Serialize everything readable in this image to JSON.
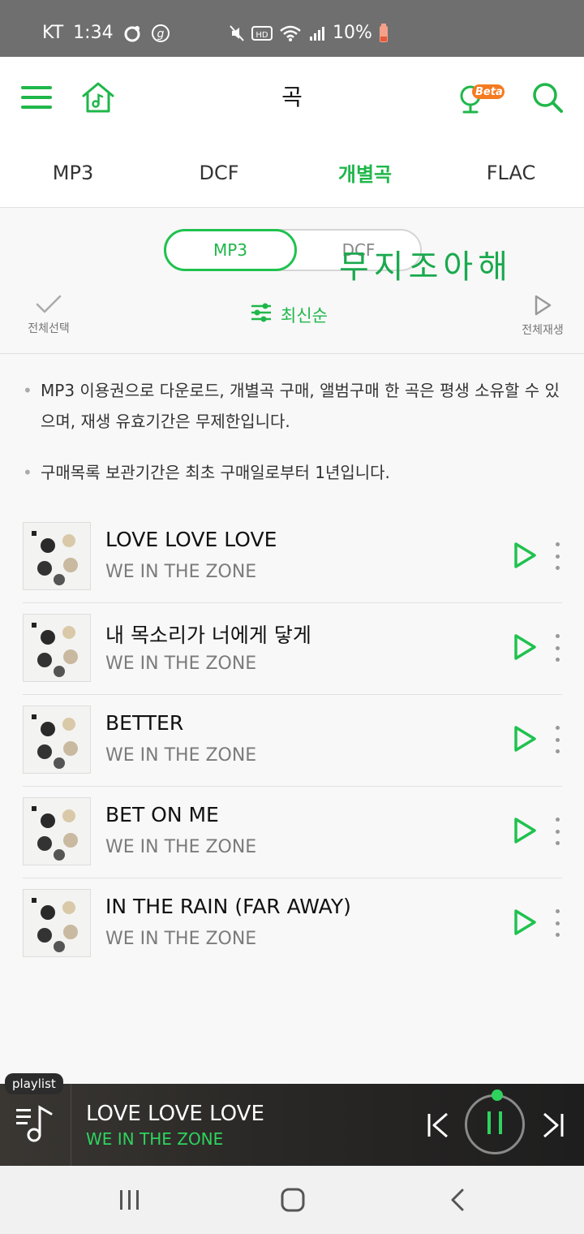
{
  "status_bar": {
    "carrier": "KT",
    "time": "1:34",
    "battery": "10%",
    "icons": [
      "circle-dot-icon",
      "g-circle-icon",
      "mute-icon",
      "hd-icon",
      "wifi-icon",
      "signal-icon",
      "battery-low-icon"
    ]
  },
  "header": {
    "title": "곡",
    "beta_badge": "Beta",
    "icons": [
      "menu-icon",
      "home-music-icon",
      "mic-beta-icon",
      "search-icon"
    ]
  },
  "tabs": [
    {
      "label": "MP3",
      "active": false
    },
    {
      "label": "DCF",
      "active": false
    },
    {
      "label": "개별곡",
      "active": true
    },
    {
      "label": "FLAC",
      "active": false
    }
  ],
  "format_toggle": {
    "selected": "MP3",
    "other": "DCF"
  },
  "handwritten_overlay": "무지조아해",
  "actions": {
    "select_all": "전체선택",
    "sort_label": "최신순",
    "play_all": "전체재생"
  },
  "notices": [
    "MP3 이용권으로 다운로드, 개별곡 구매, 앨범구매 한 곡은 평생 소유할 수 있으며, 재생 유효기간은 무제한입니다.",
    "구매목록 보관기간은 최초 구매일로부터 1년입니다."
  ],
  "songs": [
    {
      "title": "LOVE LOVE LOVE",
      "artist": "WE IN THE ZONE"
    },
    {
      "title": "내 목소리가 너에게 닿게",
      "artist": "WE IN THE ZONE"
    },
    {
      "title": "BETTER",
      "artist": "WE IN THE ZONE"
    },
    {
      "title": "BET ON ME",
      "artist": "WE IN THE ZONE"
    },
    {
      "title": "IN THE RAIN (FAR AWAY)",
      "artist": "WE IN THE ZONE"
    }
  ],
  "mini_player": {
    "tag": "playlist",
    "title": "LOVE LOVE LOVE",
    "artist": "WE IN THE ZONE",
    "state": "playing"
  },
  "colors": {
    "accent": "#1fb74a",
    "status_bar": "#6f6f6f",
    "player_bg": "#2a2826"
  }
}
